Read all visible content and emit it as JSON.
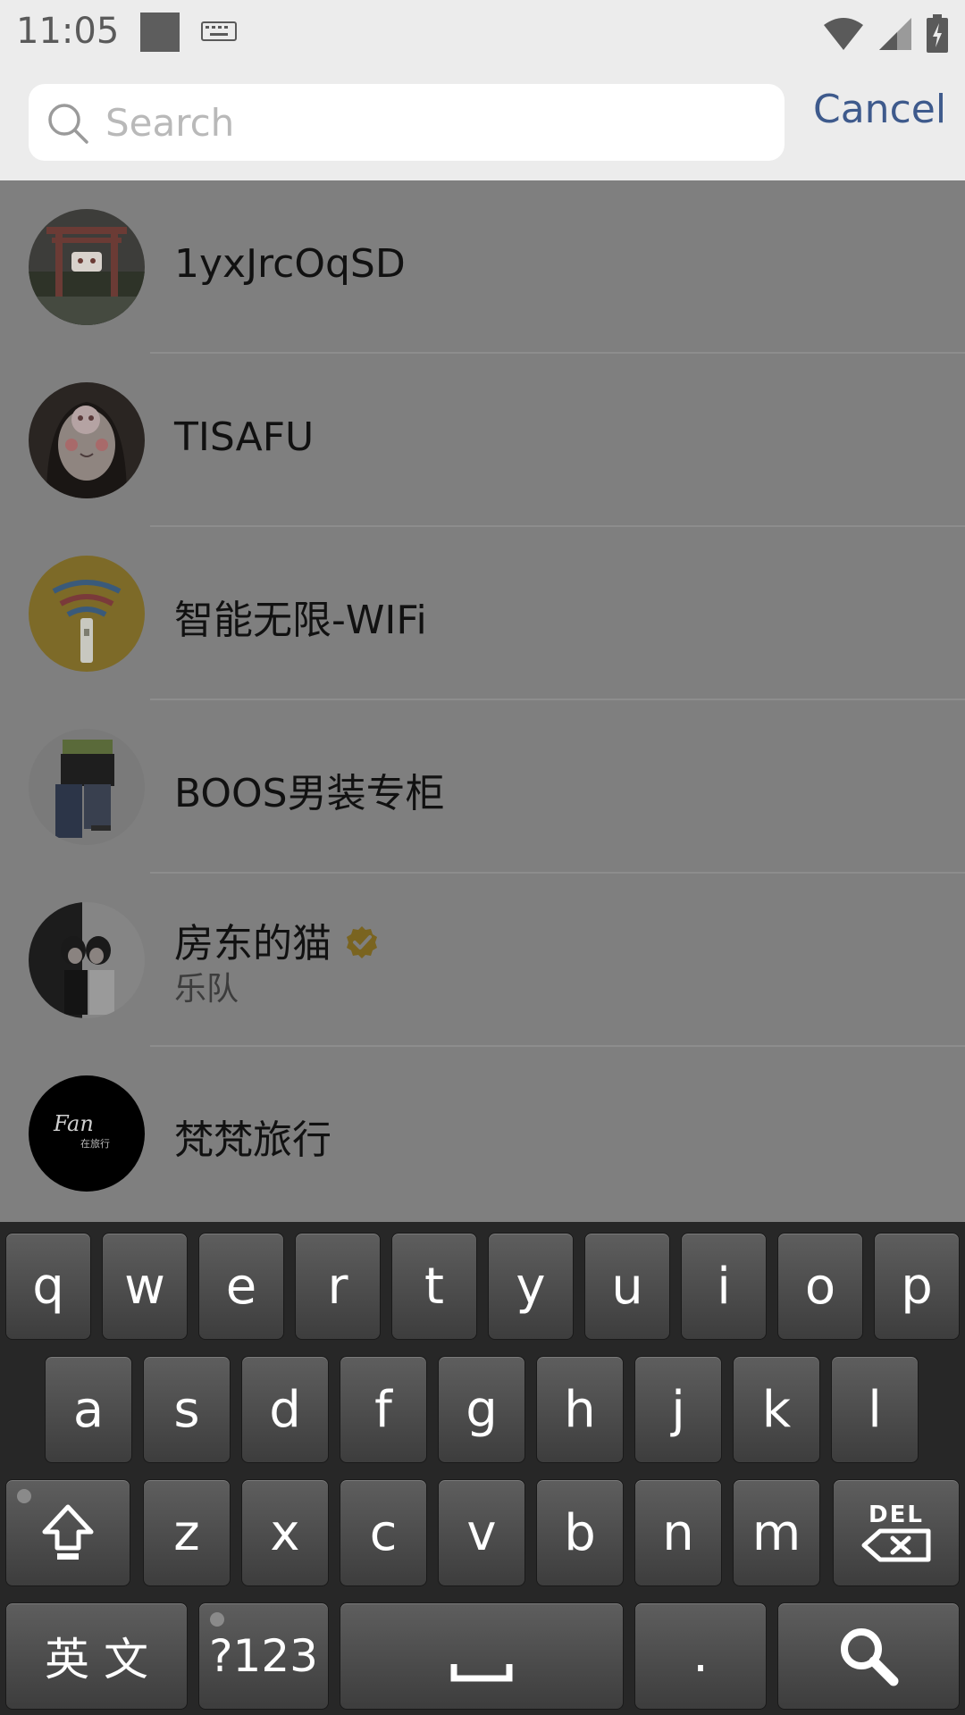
{
  "status_bar": {
    "time": "11:05"
  },
  "search": {
    "placeholder": "Search",
    "cancel_label": "Cancel"
  },
  "results": [
    {
      "title": "1yxJrcOqSD",
      "subtitle": "",
      "verified": false
    },
    {
      "title": "TISAFU",
      "subtitle": "",
      "verified": false
    },
    {
      "title": "智能无限-WIFi",
      "subtitle": "",
      "verified": false
    },
    {
      "title": "BOOS男装专柜",
      "subtitle": "",
      "verified": false
    },
    {
      "title": "房东的猫",
      "subtitle": "乐队",
      "verified": true
    },
    {
      "title": "梵梵旅行",
      "subtitle": "",
      "verified": false
    }
  ],
  "avatar_texts": {
    "fan_logo_main": "Fan",
    "fan_logo_sub": "在旅行"
  },
  "keyboard": {
    "row1": [
      "q",
      "w",
      "e",
      "r",
      "t",
      "y",
      "u",
      "i",
      "o",
      "p"
    ],
    "row2": [
      "a",
      "s",
      "d",
      "f",
      "g",
      "h",
      "j",
      "k",
      "l"
    ],
    "row3": [
      "z",
      "x",
      "c",
      "v",
      "b",
      "n",
      "m"
    ],
    "del_label": "DEL",
    "lang_label": "英 文",
    "symbols_label": "?123",
    "period_label": "."
  },
  "colors": {
    "accent": "#3e5a8c",
    "verified": "#e0a800",
    "overlay": "#7f7f7f"
  }
}
